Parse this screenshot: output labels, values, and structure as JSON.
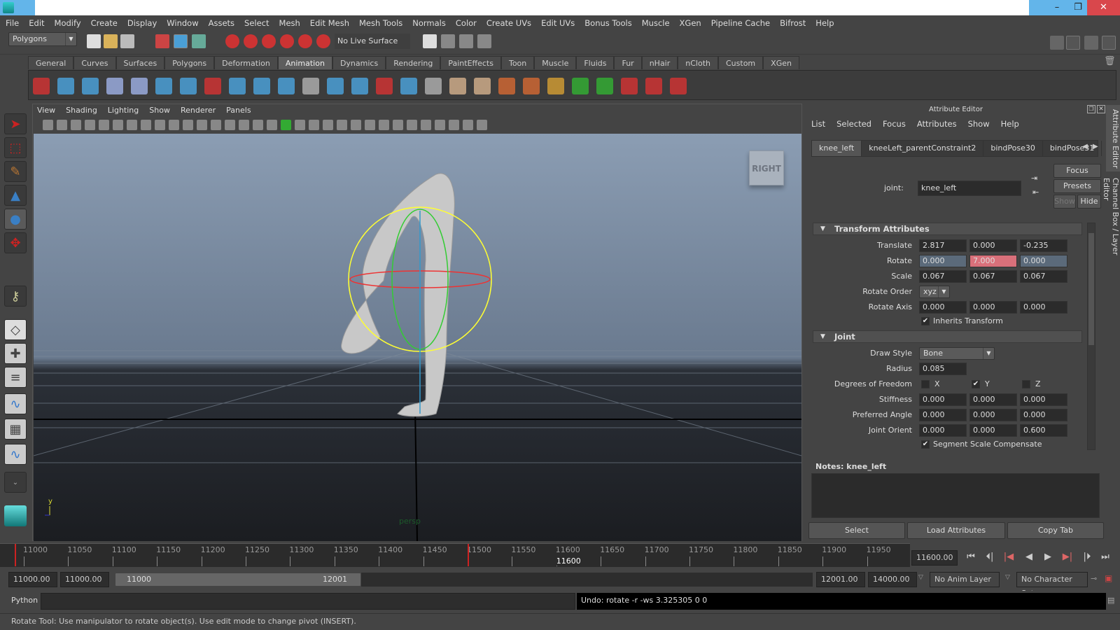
{
  "window": {
    "minimize": "–",
    "restore": "❐",
    "close": "✕"
  },
  "menubar": [
    "File",
    "Edit",
    "Modify",
    "Create",
    "Display",
    "Window",
    "Assets",
    "Select",
    "Mesh",
    "Edit Mesh",
    "Mesh Tools",
    "Normals",
    "Color",
    "Create UVs",
    "Edit UVs",
    "Bonus Tools",
    "Muscle",
    "XGen",
    "Pipeline Cache",
    "Bifrost",
    "Help"
  ],
  "statusline": {
    "menuset": "Polygons",
    "live_surface": "No Live Surface"
  },
  "shelf": {
    "tabs": [
      "General",
      "Curves",
      "Surfaces",
      "Polygons",
      "Deformation",
      "Animation",
      "Dynamics",
      "Rendering",
      "PaintEffects",
      "Toon",
      "Muscle",
      "Fluids",
      "Fur",
      "nHair",
      "nCloth",
      "Custom",
      "XGen"
    ],
    "active": "Animation"
  },
  "viewport": {
    "menu": [
      "View",
      "Shading",
      "Lighting",
      "Show",
      "Renderer",
      "Panels"
    ],
    "viewcube_label": "RIGHT",
    "camera_label": "persp",
    "axis_y": "y"
  },
  "attribute_editor": {
    "title": "Attribute Editor",
    "menu": [
      "List",
      "Selected",
      "Focus",
      "Attributes",
      "Show",
      "Help"
    ],
    "tabs": [
      "knee_left",
      "kneeLeft_parentConstraint2",
      "bindPose30",
      "bindPose31"
    ],
    "node_type_label": "joint:",
    "node_name": "knee_left",
    "buttons": {
      "focus": "Focus",
      "presets": "Presets",
      "show": "Show",
      "hide": "Hide"
    },
    "transform": {
      "title": "Transform Attributes",
      "translate": {
        "label": "Translate",
        "values": [
          "2.817",
          "0.000",
          "-0.235"
        ]
      },
      "rotate": {
        "label": "Rotate",
        "values": [
          "0.000",
          "7.000",
          "0.000"
        ]
      },
      "scale": {
        "label": "Scale",
        "values": [
          "0.067",
          "0.067",
          "0.067"
        ]
      },
      "rotate_order": {
        "label": "Rotate Order",
        "value": "xyz"
      },
      "rotate_axis": {
        "label": "Rotate Axis",
        "values": [
          "0.000",
          "0.000",
          "0.000"
        ]
      },
      "inherits_transform": {
        "label": "Inherits Transform",
        "checked": true
      }
    },
    "joint": {
      "title": "Joint",
      "draw_style": {
        "label": "Draw Style",
        "value": "Bone"
      },
      "radius": {
        "label": "Radius",
        "value": "0.085"
      },
      "dof": {
        "label": "Degrees of Freedom",
        "x": "X",
        "y": "Y",
        "z": "Z",
        "x_checked": false,
        "y_checked": true,
        "z_checked": false
      },
      "stiffness": {
        "label": "Stiffness",
        "values": [
          "0.000",
          "0.000",
          "0.000"
        ]
      },
      "preferred_angle": {
        "label": "Preferred Angle",
        "values": [
          "0.000",
          "0.000",
          "0.000"
        ]
      },
      "joint_orient": {
        "label": "Joint Orient",
        "values": [
          "0.000",
          "0.000",
          "0.600"
        ]
      },
      "segment_scale": {
        "label": "Segment Scale Compensate",
        "checked": true
      }
    },
    "notes_label": "Notes:  knee_left",
    "bottom_buttons": [
      "Select",
      "Load Attributes",
      "Copy Tab"
    ],
    "side_tabs": [
      "Attribute Editor",
      "Channel Box / Layer Editor"
    ]
  },
  "timeline": {
    "ticks": [
      "11000",
      "11050",
      "11100",
      "11150",
      "11200",
      "11250",
      "11300",
      "11350",
      "11400",
      "11450",
      "11500",
      "11550",
      "11600",
      "11650",
      "11700",
      "11750",
      "11800",
      "11850",
      "11900",
      "11950"
    ],
    "current_frame_label": "11600",
    "current_time": "11600.00"
  },
  "range": {
    "start": "11000.00",
    "anim_start": "11000.00",
    "slider_min": "11000",
    "slider_max": "12001",
    "anim_end": "12001.00",
    "end": "14000.00",
    "anim_layer": "No Anim Layer",
    "character_set": "No Character Set"
  },
  "command": {
    "lang": "Python",
    "result": "Undo: rotate -r -ws 3.325305 0 0"
  },
  "help_line": "Rotate Tool: Use manipulator to rotate object(s). Use edit mode to change pivot (INSERT).",
  "colors": {
    "keyed_field": "#d9707a",
    "connected_field": "#5b6a7a",
    "title_bar": "#63b5ea",
    "close": "#d9474c"
  }
}
